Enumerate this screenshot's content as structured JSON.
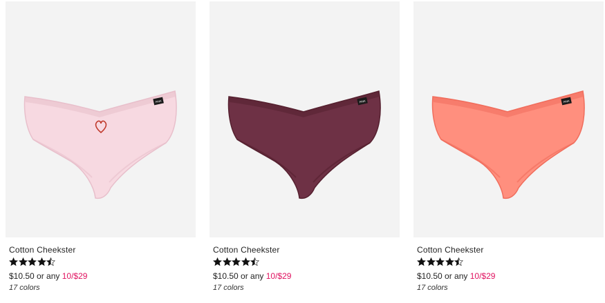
{
  "products": [
    {
      "name": "Cotton Cheekster",
      "rating": 4.5,
      "price": "$10.50",
      "price_connector": "or any",
      "promo": "10/$29",
      "colors_count": "17 colors",
      "fabric_color": "#f7d9e1",
      "shade_color": "#e8bfcb",
      "tag_text": "PINK"
    },
    {
      "name": "Cotton Cheekster",
      "rating": 4.5,
      "price": "$10.50",
      "price_connector": "or any",
      "promo": "10/$29",
      "colors_count": "17 colors",
      "fabric_color": "#6e3145",
      "shade_color": "#55202f",
      "tag_text": "PINK"
    },
    {
      "name": "Cotton Cheekster",
      "rating": 4.5,
      "price": "$10.50",
      "price_connector": "or any",
      "promo": "10/$29",
      "colors_count": "17 colors",
      "fabric_color": "#ff8f7e",
      "shade_color": "#f06d5c",
      "tag_text": "PINK"
    }
  ]
}
